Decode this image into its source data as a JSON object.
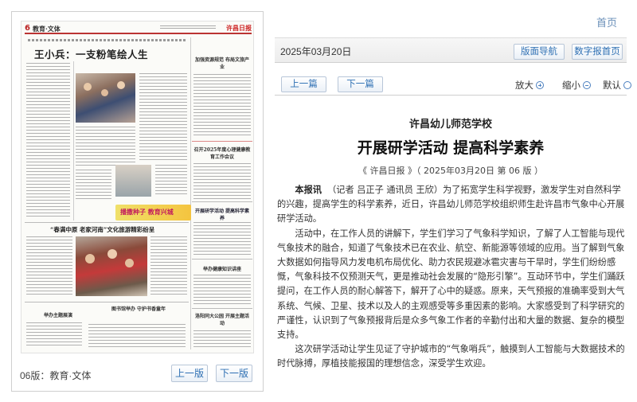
{
  "newspaper": {
    "page_number": "6",
    "section": "教育·文体",
    "masthead": "许昌日报",
    "main_headline": "王小兵：一支粉笔绘人生",
    "side_headline_1": "加强资源规范 布局文旅产业",
    "side_headline_2": "召开2025年度心理健康教育工作会议",
    "side_headline_3": "开展研学活动 提高科学素养",
    "side_headline_4": "举办健康知识讲座",
    "side_headline_5": "洛阳同大公园 开展主题活动",
    "side_headline_6": "举办主题展演",
    "side_headline_7": "图书馆举办 守护书香童年",
    "feature_headline": "“春满中原 老家河南”文化旅游精彩纷呈",
    "banner_text": "播撒种子 教育兴城",
    "page_label": "06版：教育·文体",
    "prev_page_label": "上一版",
    "next_page_label": "下一版"
  },
  "header": {
    "home_link": "首页",
    "date": "2025年03月20日",
    "layout_nav_label": "版面导航",
    "digital_home_label": "数字报首页"
  },
  "toolbar": {
    "prev_article_label": "上一篇",
    "next_article_label": "下一篇",
    "zoom_in_label": "放大",
    "zoom_out_label": "缩小",
    "default_label": "默认"
  },
  "article": {
    "organization": "许昌幼儿师范学校",
    "title": "开展研学活动 提高科学素养",
    "source_line": "《 许昌日报 》（ 2025年03月20日 第 06 版 ）",
    "lead_label": "本报讯",
    "paragraph_1": "（记者 吕正子 通讯员 王欣）为了拓宽学生科学视野，激发学生对自然科学的兴趣，提高学生的科学素养，近日，许昌幼儿师范学校组织师生赴许昌市气象中心开展研学活动。",
    "paragraph_2": "活动中，在工作人员的讲解下，学生们学习了气象科学知识，了解了人工智能与现代气象技术的融合，知道了气象技术已在农业、航空、新能源等领域的应用。当了解到气象大数据如何指导风力发电机布局优化、助力农民规避冰雹灾害与干旱时，学生们纷纷感慨，气象科技不仅预测天气，更是推动社会发展的“隐形引擎”。互动环节中，学生们踊跃提问，在工作人员的耐心解答下，解开了心中的疑惑。原来，天气预报的准确率受到大气系统、气候、卫星、技术以及人的主观感受等多重因素的影响。大家感受到了科学研究的严谨性，认识到了气象预报背后是众多气象工作者的辛勤付出和大量的数据、复杂的模型支持。",
    "paragraph_3": "这次研学活动让学生见证了守护城市的“气象哨兵”，触摸到人工智能与大数据技术的时代脉搏，厚植技能报国的理想信念，深受学生欢迎。"
  },
  "colors": {
    "accent_red": "#cc2222",
    "link_blue": "#2d6fb3",
    "banner_yellow": "#f0e06a"
  }
}
